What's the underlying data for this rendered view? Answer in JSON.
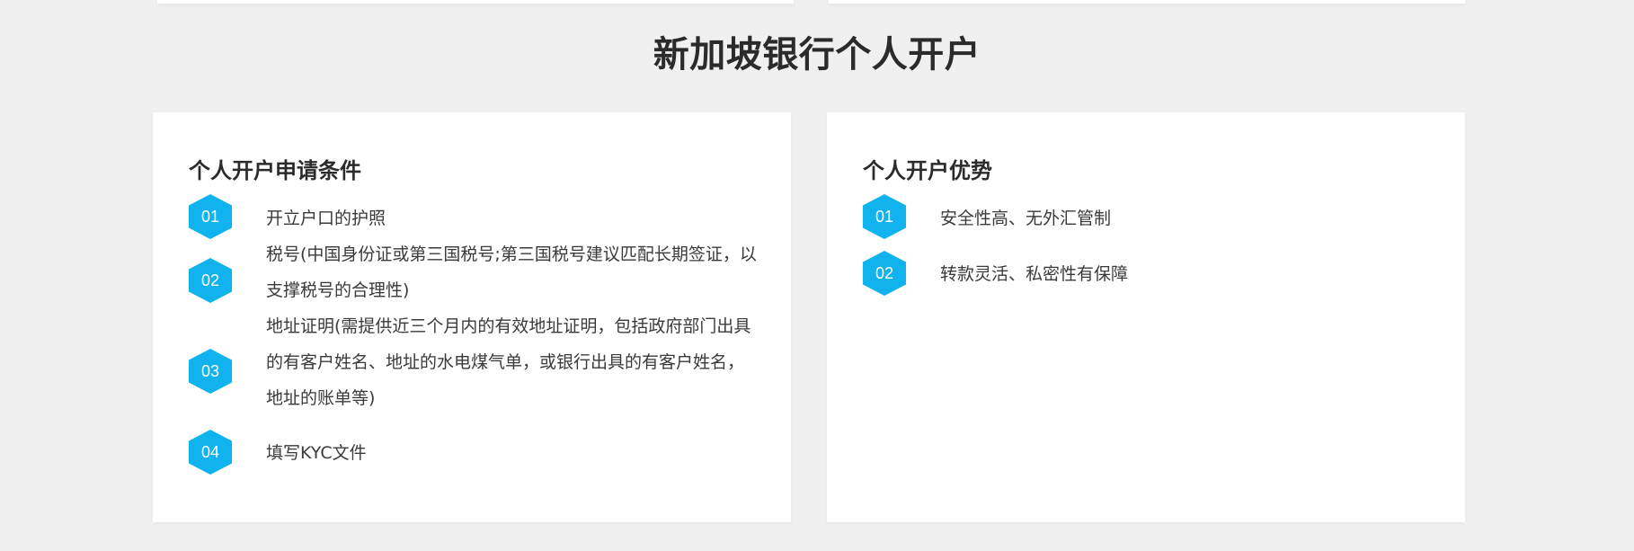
{
  "page": {
    "title": "新加坡银行个人开户"
  },
  "requirements": {
    "title": "个人开户申请条件",
    "items": [
      {
        "number": "01",
        "text": "开立户口的护照"
      },
      {
        "number": "02",
        "text": "税号(中国身份证或第三国税号;第三国税号建议匹配长期签证，以支撑税号的合理性)"
      },
      {
        "number": "03",
        "text": "地址证明(需提供近三个月内的有效地址证明，包括政府部门出具的有客户姓名、地址的水电煤气单，或银行出具的有客户姓名，地址的账单等)"
      },
      {
        "number": "04",
        "text": "填写KYC文件"
      }
    ]
  },
  "advantages": {
    "title": "个人开户优势",
    "items": [
      {
        "number": "01",
        "text": "安全性高、无外汇管制"
      },
      {
        "number": "02",
        "text": "转款灵活、私密性有保障"
      }
    ]
  },
  "colors": {
    "accent": "#10b3ee",
    "background": "#f0f0f0",
    "card": "#ffffff",
    "title": "#2b2b2b"
  }
}
